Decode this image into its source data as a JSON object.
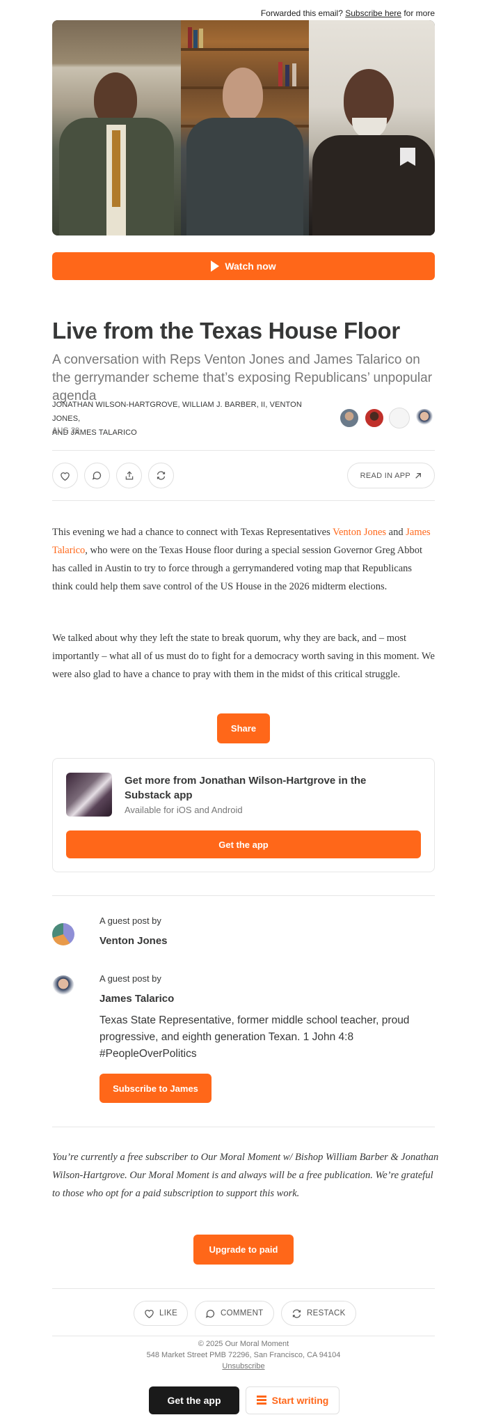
{
  "header": {
    "forward_text": "Forwarded this email?",
    "subscribe_link": "Subscribe here",
    "forward_suffix": "for more"
  },
  "video": {
    "watch_label": "Watch now"
  },
  "post": {
    "title": "Live from the Texas House Floor",
    "subtitle": "A conversation with Reps Venton Jones and James Talarico on the gerrymander scheme that’s exposing Republicans’ unpopular agenda",
    "authors_line1": "JONATHAN WILSON-HARTGROVE, WILLIAM J. BARBER, II, VENTON JONES,",
    "authors_line2": "AND JAMES TALARICO",
    "date": "AUG 20"
  },
  "actions": {
    "read_in_app": "READ IN APP"
  },
  "body": {
    "p1_a": "This evening we had a chance to connect with Texas Representatives ",
    "p1_link1": "Venton Jones",
    "p1_b": " and ",
    "p1_link2": "James Talarico",
    "p1_c": ", who were on the Texas House floor during a special session Governor Greg Abbot has called in Austin to try to force through a gerrymandered voting map that Republicans think could help them save control of the US House in the 2026 midterm elections.",
    "p2": "We talked about why they left the state to break quorum, why they are back, and – most importantly – what all of us must do to fight for a democracy worth saving in this moment. We were also glad to have a chance to pray with them in the midst of this critical struggle.",
    "share_label": "Share"
  },
  "app_card": {
    "title": "Get more from Jonathan Wilson-Hartgrove in the Substack app",
    "subtitle": "Available for iOS and Android",
    "button": "Get the app"
  },
  "guests": [
    {
      "label": "A guest post by",
      "name": "Venton Jones"
    },
    {
      "label": "A guest post by",
      "name": "James Talarico",
      "bio": "Texas State Representative, former middle school teacher, proud progressive, and eighth generation Texan. 1 John 4:8 #PeopleOverPolitics",
      "button": "Subscribe to James"
    }
  ],
  "free_note": "You’re currently a free subscriber to Our Moral Moment w/ Bishop William Barber & Jonathan Wilson-Hartgrove. Our Moral Moment is and always will be a free publication. We’re grateful to those who opt for a paid subscription to support this work.",
  "upgrade_label": "Upgrade to paid",
  "engage": {
    "like": "LIKE",
    "comment": "COMMENT",
    "restack": "RESTACK"
  },
  "footer": {
    "copyright": "© 2025 Our Moral Moment",
    "address": "548 Market Street PMB 72296, San Francisco, CA 94104",
    "unsubscribe": "Unsubscribe",
    "get_app": "Get the app",
    "start_writing": "Start writing"
  },
  "colors": {
    "accent": "#ff6719",
    "text": "#363737",
    "muted": "#777777"
  }
}
